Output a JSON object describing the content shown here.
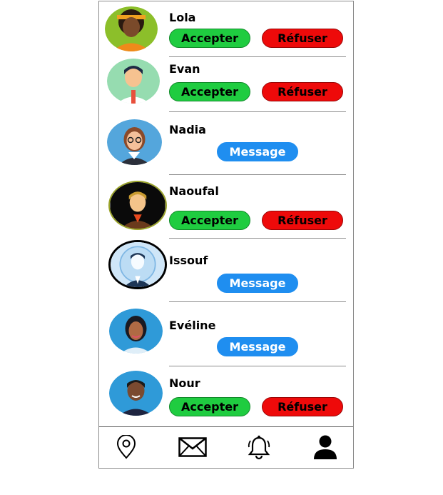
{
  "contacts": [
    {
      "name": "Lola",
      "actions": [
        "Accepter",
        "Refuser"
      ]
    },
    {
      "name": "Evan",
      "actions": [
        "Accepter",
        "Refuser"
      ]
    },
    {
      "name": "Nadia",
      "actions": [
        "Message"
      ]
    },
    {
      "name": "Naoufal",
      "actions": [
        "Accepter",
        "Refuser"
      ]
    },
    {
      "name": "Issouf",
      "actions": [
        "Message"
      ]
    },
    {
      "name": "Eveline",
      "actions": [
        "Message"
      ]
    },
    {
      "name": "Nour",
      "actions": [
        "Accepter",
        "Refuser"
      ]
    }
  ],
  "labels": {
    "accept": "Accepter",
    "refuse": "Réfuser",
    "message": "Message"
  },
  "contact_names": {
    "lola": "Lola",
    "evan": "Evan",
    "nadia": "Nadia",
    "naoufal": "Naoufal",
    "issouf": "Issouf",
    "eveline": "Evéline",
    "nour": "Nour"
  },
  "bottom_nav": [
    {
      "icon": "location-pin-icon"
    },
    {
      "icon": "mail-icon"
    },
    {
      "icon": "bell-icon"
    },
    {
      "icon": "user-icon"
    }
  ],
  "colors": {
    "accept": "#1fcc40",
    "refuse": "#ee0a0a",
    "message": "#1f8ef0"
  }
}
